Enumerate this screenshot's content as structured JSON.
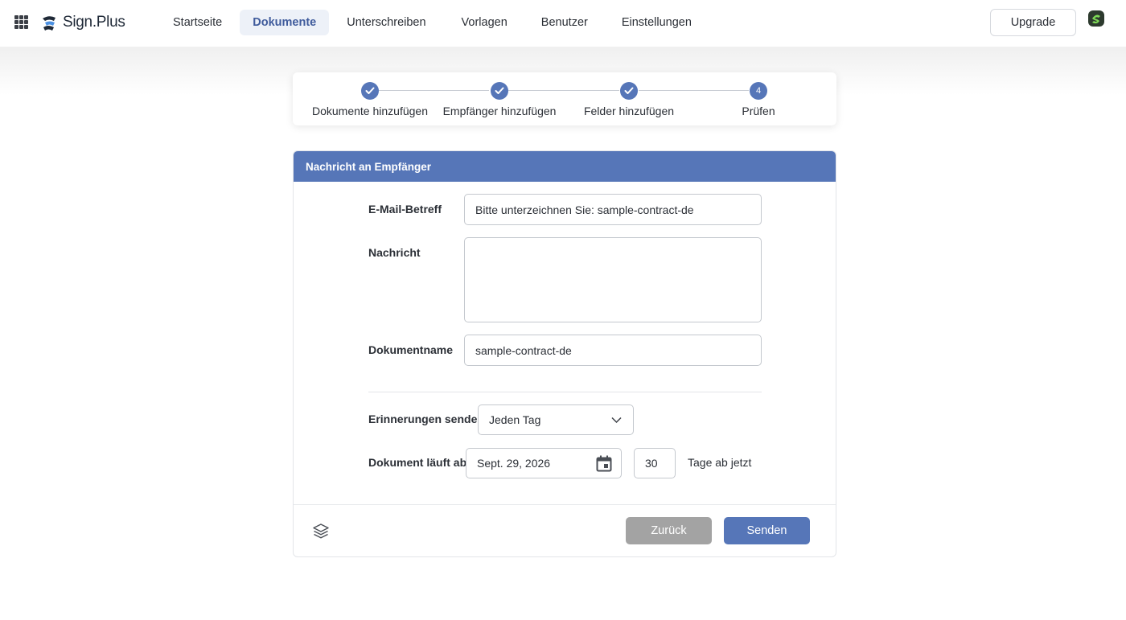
{
  "app": {
    "name": "Sign.Plus"
  },
  "nav": {
    "items": [
      {
        "label": "Startseite"
      },
      {
        "label": "Dokumente"
      },
      {
        "label": "Unterschreiben"
      },
      {
        "label": "Vorlagen"
      },
      {
        "label": "Benutzer"
      },
      {
        "label": "Einstellungen"
      }
    ],
    "active": "Dokumente",
    "upgrade_label": "Upgrade"
  },
  "stepper": {
    "steps": [
      {
        "label": "Dokumente hinzufügen",
        "state": "done"
      },
      {
        "label": "Empfänger hinzufügen",
        "state": "done"
      },
      {
        "label": "Felder hinzufügen",
        "state": "done"
      },
      {
        "label": "Prüfen",
        "state": "current",
        "number": "4"
      }
    ]
  },
  "form": {
    "header": "Nachricht an Empfänger",
    "subject_label": "E-Mail-Betreff",
    "subject_value": "Bitte unterzeichnen Sie: sample-contract-de",
    "message_label": "Nachricht",
    "message_value": "",
    "docname_label": "Dokumentname",
    "docname_value": "sample-contract-de",
    "reminder_label": "Erinnerungen senden",
    "reminder_value": "Jeden Tag",
    "expires_label": "Dokument läuft ab",
    "expires_date": "Sept. 29, 2026",
    "expires_days": "30",
    "expires_suffix": "Tage ab jetzt"
  },
  "actions": {
    "back_label": "Zurück",
    "send_label": "Senden"
  },
  "colors": {
    "accent": "#5676b8",
    "back_button": "#a3a3a3",
    "nav_active_bg": "#edf1f8"
  },
  "icons": [
    "apps-grid-icon",
    "sign-plus-logo-icon",
    "avatar-icon",
    "check-icon",
    "chevron-down-icon",
    "calendar-icon",
    "layers-icon"
  ]
}
